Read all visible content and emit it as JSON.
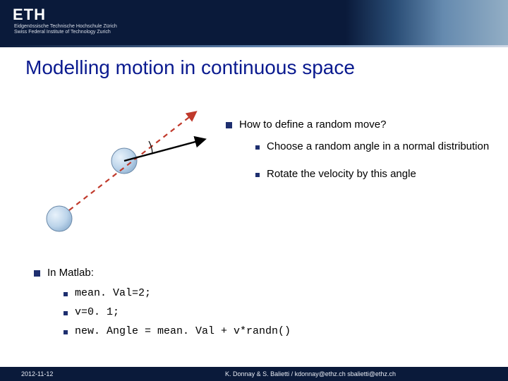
{
  "header": {
    "logo": "ETH",
    "subtitle_line1": "Eidgenössische Technische Hochschule Zürich",
    "subtitle_line2": "Swiss Federal Institute of Technology Zurich"
  },
  "title": "Modelling motion in continuous space",
  "main_bullet": "How to define a random move?",
  "sub_bullets": [
    "Choose a random angle in a normal distribution",
    "Rotate the velocity by this angle"
  ],
  "matlab_heading": "In Matlab:",
  "matlab_lines": [
    "mean. Val=2;",
    "v=0. 1;",
    "new. Angle = mean. Val + v*randn()"
  ],
  "footer": {
    "date": "2012-11-12",
    "credits": "K. Donnay & S. Balietti  /  kdonnay@ethz.ch   sbalietti@ethz.ch"
  }
}
